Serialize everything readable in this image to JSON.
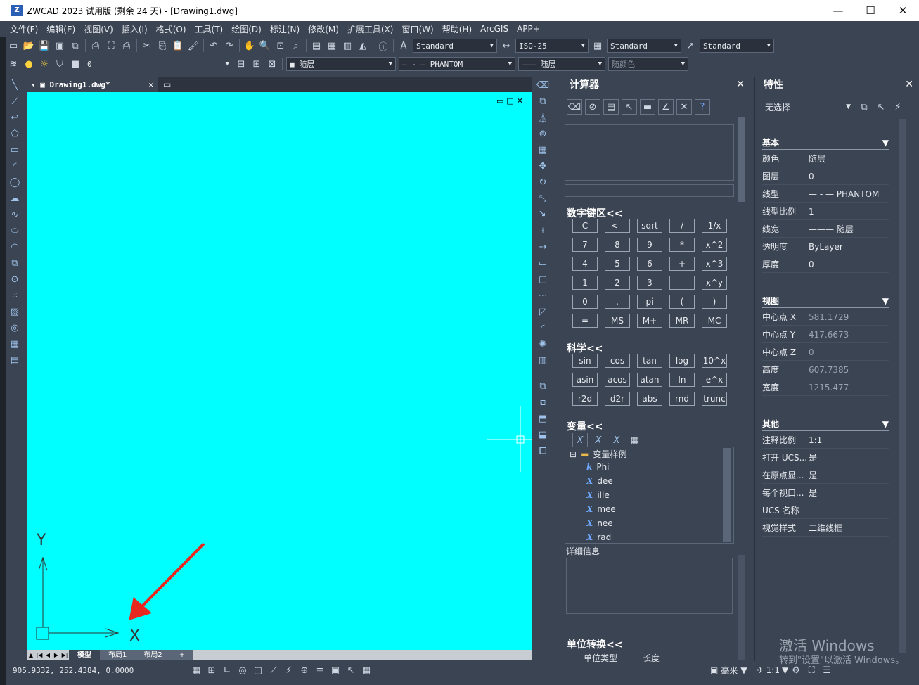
{
  "window": {
    "title": "ZWCAD 2023 试用版 (剩余 24 天) - [Drawing1.dwg]",
    "icon": "zwcad-app-icon"
  },
  "menu": [
    "文件(F)",
    "编辑(E)",
    "视图(V)",
    "插入(I)",
    "格式(O)",
    "工具(T)",
    "绘图(D)",
    "标注(N)",
    "修改(M)",
    "扩展工具(X)",
    "窗口(W)",
    "帮助(H)",
    "ArcGIS",
    "APP+"
  ],
  "toolbar": {
    "text_style": "Standard",
    "dim_style": "ISO-25",
    "table_style": "Standard",
    "mleader_style": "Standard",
    "layer": "0",
    "color": "随层",
    "linetype": "PHANTOM",
    "lineweight": "随层",
    "plotstyle": "随颜色"
  },
  "document": {
    "tab": "Drawing1.dwg*"
  },
  "canvas": {
    "bg": "#00ffff",
    "ucs_x": "X",
    "ucs_y": "Y"
  },
  "layouts": [
    "模型",
    "布局1",
    "布局2",
    "+"
  ],
  "status": {
    "coords": "905.9332, 252.4384, 0.0000",
    "units": "毫米",
    "scale": "1:1"
  },
  "calculator": {
    "title": "计算器",
    "keypad_title": "数字键区<<",
    "keypad": [
      [
        "C",
        "<--",
        "sqrt",
        "/",
        "1/x"
      ],
      [
        "7",
        "8",
        "9",
        "*",
        "x^2"
      ],
      [
        "4",
        "5",
        "6",
        "+",
        "x^3"
      ],
      [
        "1",
        "2",
        "3",
        "-",
        "x^y"
      ],
      [
        "0",
        ".",
        "pi",
        "(",
        ")"
      ],
      [
        "=",
        "MS",
        "M+",
        "MR",
        "MC"
      ]
    ],
    "sci_title": "科学<<",
    "sci": [
      [
        "sin",
        "cos",
        "tan",
        "log",
        "10^x"
      ],
      [
        "asin",
        "acos",
        "atan",
        "ln",
        "e^x"
      ],
      [
        "r2d",
        "d2r",
        "abs",
        "rnd",
        "trunc"
      ]
    ],
    "var_title": "变量<<",
    "var_folder": "变量样例",
    "vars": [
      {
        "icon": "k",
        "name": "Phi"
      },
      {
        "icon": "X",
        "name": "dee"
      },
      {
        "icon": "X",
        "name": "ille"
      },
      {
        "icon": "X",
        "name": "mee"
      },
      {
        "icon": "X",
        "name": "nee"
      },
      {
        "icon": "X",
        "name": "rad"
      }
    ],
    "details": "详细信息",
    "unit_title": "单位转换<<",
    "unit_type": "单位类型",
    "unit_value": "长度"
  },
  "properties": {
    "title": "特性",
    "selection": "无选择",
    "basic_title": "基本",
    "basic": [
      {
        "k": "颜色",
        "v": "随层"
      },
      {
        "k": "图层",
        "v": "0"
      },
      {
        "k": "线型",
        "v": "— - — PHANTOM"
      },
      {
        "k": "线型比例",
        "v": "1"
      },
      {
        "k": "线宽",
        "v": "——— 随层"
      },
      {
        "k": "透明度",
        "v": "ByLayer"
      },
      {
        "k": "厚度",
        "v": "0"
      }
    ],
    "view_title": "视图",
    "view": [
      {
        "k": "中心点 X",
        "v": "581.1729"
      },
      {
        "k": "中心点 Y",
        "v": "417.6673"
      },
      {
        "k": "中心点 Z",
        "v": "0"
      },
      {
        "k": "高度",
        "v": "607.7385"
      },
      {
        "k": "宽度",
        "v": "1215.477"
      }
    ],
    "other_title": "其他",
    "other": [
      {
        "k": "注释比例",
        "v": "1:1"
      },
      {
        "k": "打开 UCS...",
        "v": "是"
      },
      {
        "k": "在原点显...",
        "v": "是"
      },
      {
        "k": "每个视口...",
        "v": "是"
      },
      {
        "k": "UCS 名称",
        "v": ""
      },
      {
        "k": "视觉样式",
        "v": "二维线框"
      }
    ]
  },
  "watermark": {
    "line1": "激活 Windows",
    "line2": "转到\"设置\"以激活 Windows。"
  }
}
